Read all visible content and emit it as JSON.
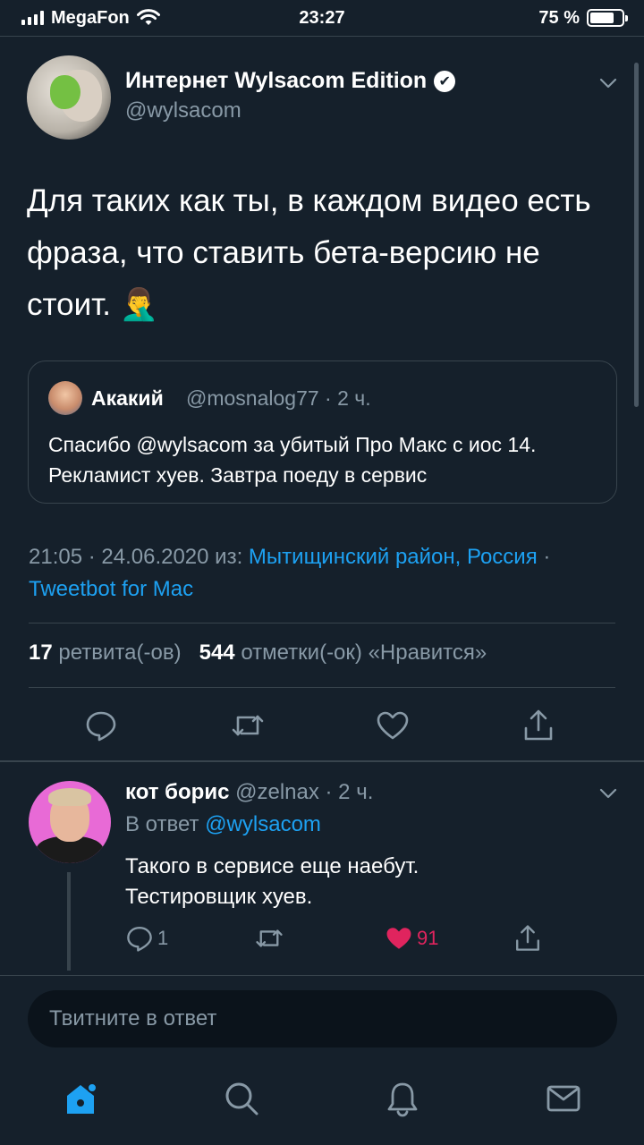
{
  "status_bar": {
    "carrier": "MegaFon",
    "time": "23:27",
    "battery": "75 %",
    "battery_level": 0.75
  },
  "tweet": {
    "author_name": "Интернет Wylsacom Edition",
    "verified_mark": "✔",
    "author_handle": "@wylsacom",
    "text": "Для таких как ты, в каждом видео есть фраза, что ставить бета-версию не стоит. 🤦‍♂️",
    "quote": {
      "author_name": "Акакий",
      "meta": "@mosnalog77 · 2 ч.",
      "text": "Спасибо @wylsacom за убитый Про Макс с иос 14. Рекламист хуев. Завтра поеду в сервис"
    },
    "timestamp": "21:05 · 24.06.2020 из:",
    "location": "Мытищинский район, Россия",
    "separator": "·",
    "client": "Tweetbot for Mac",
    "retweets_count": "17",
    "retweets_label": "ретвита(-ов)",
    "likes_count": "544",
    "likes_label": "отметки(-ок) «Нравится»"
  },
  "reply": {
    "author_name": "кот борис",
    "meta": "@zelnax · 2 ч.",
    "reply_to_prefix": "В ответ",
    "reply_to_handle": "@wylsacom",
    "text_line1": "Такого в сервисе еще наебут.",
    "text_line2": "Тестировщик хуев.",
    "reply_count": "1",
    "like_count": "91"
  },
  "compose": {
    "placeholder": "Твитните в ответ"
  },
  "icons": {
    "status": [
      "signal-icon",
      "wifi-icon",
      "battery-icon"
    ],
    "actions": [
      "reply-icon",
      "retweet-icon",
      "like-icon",
      "share-icon"
    ],
    "nav": [
      "home-icon",
      "search-icon",
      "notifications-icon",
      "messages-icon"
    ],
    "accent": "#1da1f2",
    "like_color": "#e0245e"
  }
}
